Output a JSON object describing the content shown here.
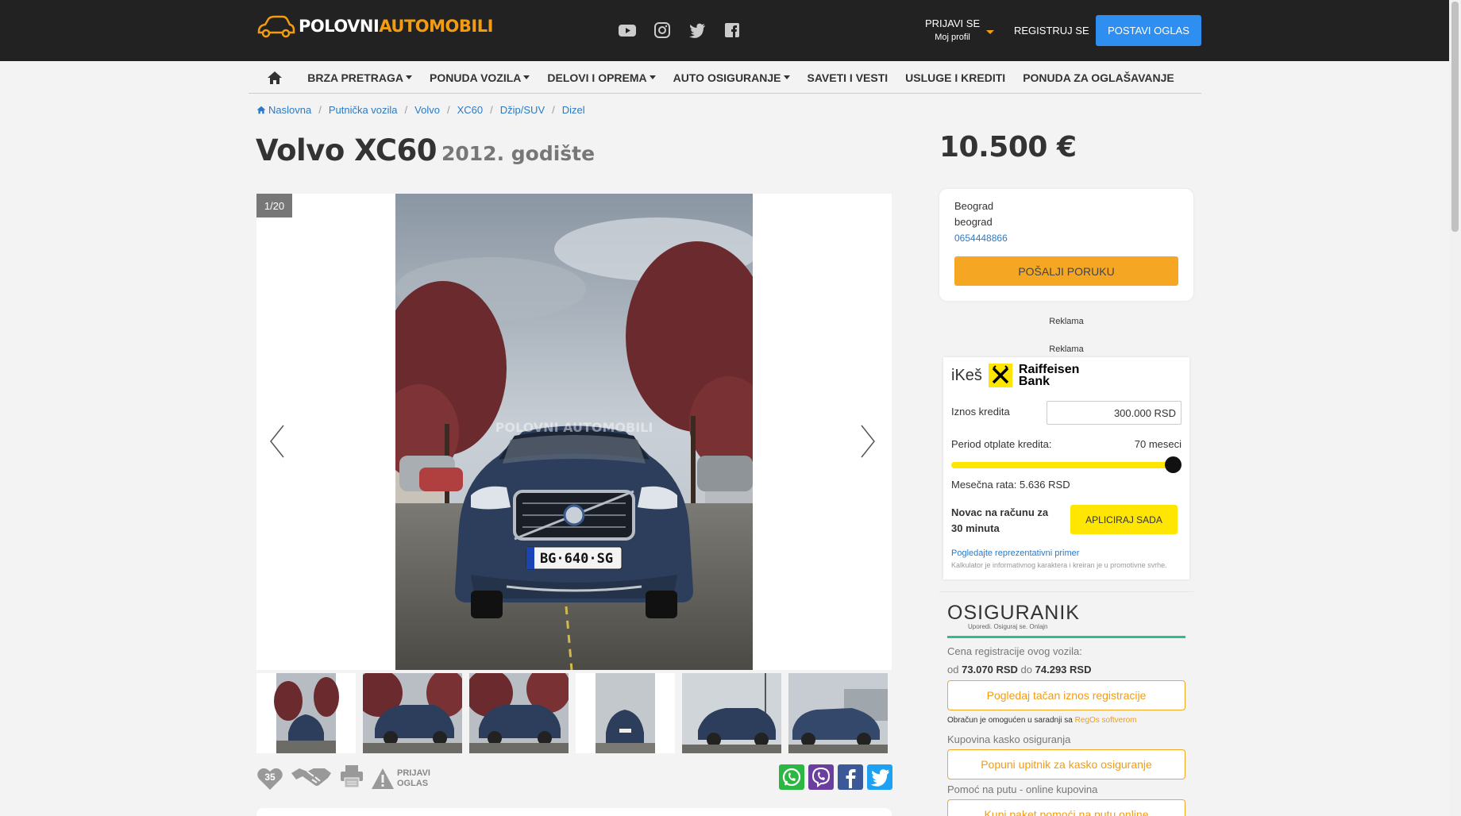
{
  "header": {
    "logo_white": "POLOVNI",
    "logo_orange": "AUTOMOBILI",
    "login_label": "PRIJAVI SE",
    "login_sub": "Moj profil",
    "register_label": "REGISTRUJ SE",
    "post_ad_label": "POSTAVI OGLAS",
    "social_icons": [
      "youtube-icon",
      "instagram-icon",
      "twitter-icon",
      "facebook-icon"
    ]
  },
  "nav": {
    "items": [
      {
        "label": "BRZA PRETRAGA"
      },
      {
        "label": "PONUDA VOZILA"
      },
      {
        "label": "DELOVI I OPREMA"
      },
      {
        "label": "AUTO OSIGURANJE"
      },
      {
        "label": "SAVETI I VESTI"
      },
      {
        "label": "USLUGE I KREDITI"
      },
      {
        "label": "PONUDA ZA OGLAŠAVANJE"
      }
    ]
  },
  "breadcrumb": [
    "Naslovna",
    "Putnička vozila",
    "Volvo",
    "XC60",
    "Džip/SUV",
    "Dizel"
  ],
  "listing": {
    "title": "Volvo XC60",
    "year": "2012. godište",
    "price": "10.500 €",
    "photo_counter": "1/20",
    "plate": "BG·640·SG",
    "watermark": "POLOVNI AUTOMOBILI",
    "favorites_count": "35",
    "report_line1": "PRIJAVI",
    "report_line2": "OGLAS"
  },
  "seller": {
    "city": "Beograd",
    "region": "beograd",
    "phone": "0654448866",
    "send_label": "POŠALJI PORUKU"
  },
  "ads": {
    "label": "Reklama"
  },
  "ikes": {
    "brand": "iKeš",
    "bank_line1": "Raiffeisen",
    "bank_line2": "Bank",
    "amount_label": "Iznos kredita",
    "amount_value": "300.000 RSD",
    "period_label": "Period otplate kredita:",
    "period_value": "70 meseci",
    "period_fraction": 1.0,
    "rate": "Mesečna rata: 5.636 RSD",
    "cash_line1": "Novac na računu za",
    "cash_line2": "30 minuta",
    "apply_label": "APLICIRAJ SADA",
    "rep_link": "Pogledajte reprezentativni primer",
    "disclaimer": "Kalkulator je informativnog karaktera i kreiran je u promotivne svrhe.",
    "accent_color": "#fee600"
  },
  "osiguranik": {
    "logo": "OSIGURANIK",
    "tagline": "Uporedi. Osiguraj se. Onlajn",
    "reg_label": "Cena registracije ovog vozila:",
    "reg_from_word": "od",
    "reg_from": "73.070 RSD",
    "reg_to_word": "do",
    "reg_to": "74.293 RSD",
    "reg_btn": "Pogledaj tačan iznos registracije",
    "note_prefix": "Obračun je omogućen u saradnji sa",
    "note_link": "RegOs softverom",
    "kasko_label": "Kupovina kasko osiguranja",
    "kasko_btn": "Popuni upitnik za kasko osiguranje",
    "help_label": "Pomoć na putu - online kupovina",
    "help_btn": "Kupi paket pomoći na putu online"
  },
  "colors": {
    "topbar": "#222222",
    "brand_orange": "#f39c12",
    "primary_blue": "#2e8ff0",
    "link_blue": "#2a7ac7"
  }
}
